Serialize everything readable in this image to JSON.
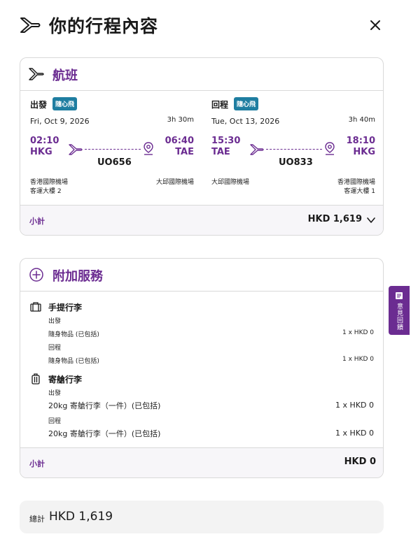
{
  "header": {
    "title": "你的行程內容"
  },
  "flights": {
    "title": "航班",
    "legs": [
      {
        "direction": "出發",
        "badge": "隨心飛",
        "date": "Fri, Oct 9, 2026",
        "duration": "3h 30m",
        "dep_time": "02:10",
        "dep_code": "HKG",
        "arr_time": "06:40",
        "arr_code": "TAE",
        "flight_no": "UO656",
        "dep_airport": "香港國際機場",
        "dep_terminal": "客運大樓 2",
        "arr_airport": "大邱國際機場",
        "arr_terminal": ""
      },
      {
        "direction": "回程",
        "badge": "隨心飛",
        "date": "Tue, Oct 13, 2026",
        "duration": "3h 40m",
        "dep_time": "15:30",
        "dep_code": "TAE",
        "arr_time": "18:10",
        "arr_code": "HKG",
        "flight_no": "UO833",
        "dep_airport": "大邱國際機場",
        "dep_terminal": "",
        "arr_airport": "香港國際機場",
        "arr_terminal": "客運大樓 1"
      }
    ],
    "subtotal_label": "小計",
    "subtotal": "HKD 1,619"
  },
  "addons": {
    "title": "附加服務",
    "carry_on": {
      "title": "手提行李",
      "outbound_label": "出發",
      "outbound_item": "隨身物品 (已包括)",
      "outbound_amount": "1 x HKD 0",
      "return_label": "回程",
      "return_item": "隨身物品 (已包括)",
      "return_amount": "1 x HKD 0"
    },
    "checked": {
      "title": "寄艙行李",
      "outbound_label": "出發",
      "outbound_item": "20kg 寄艙行李（一件）(已包括)",
      "outbound_amount": "1 x HKD 0",
      "return_label": "回程",
      "return_item": "20kg 寄艙行李（一件）(已包括)",
      "return_amount": "1 x HKD 0"
    },
    "subtotal_label": "小計",
    "subtotal": "HKD 0"
  },
  "total": {
    "label": "總計",
    "amount": "HKD 1,619"
  },
  "feedback": {
    "label": "意見回饋"
  },
  "colors": {
    "accent": "#6b2c91",
    "badge": "#1f7ea1"
  }
}
